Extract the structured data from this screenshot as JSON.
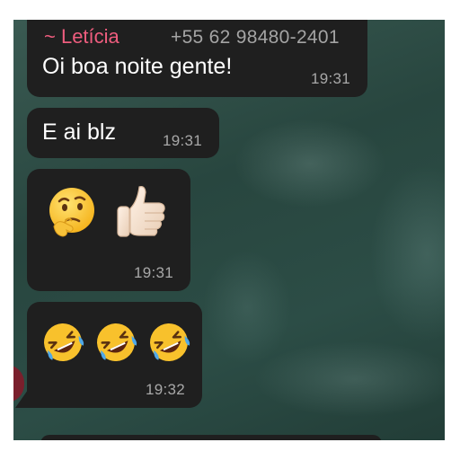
{
  "messages": [
    {
      "sender": "~ Letícia",
      "phone": "+55 62 98480-2401",
      "text": "Oi boa noite gente!",
      "time": "19:31"
    },
    {
      "text": "E ai blz",
      "time": "19:31"
    },
    {
      "emojis": [
        "thinking-face",
        "thumbs-up-light-skin"
      ],
      "time": "19:31"
    },
    {
      "emojis": [
        "rolling-on-floor-laughing",
        "rolling-on-floor-laughing",
        "rolling-on-floor-laughing"
      ],
      "time": "19:32"
    }
  ],
  "colors": {
    "bubble": "#1f1f1f",
    "sender_name": "#ee5d7e",
    "phone": "#a4a4a4",
    "timestamp": "#a8a8a8",
    "avatar": "#7a1f2c"
  }
}
